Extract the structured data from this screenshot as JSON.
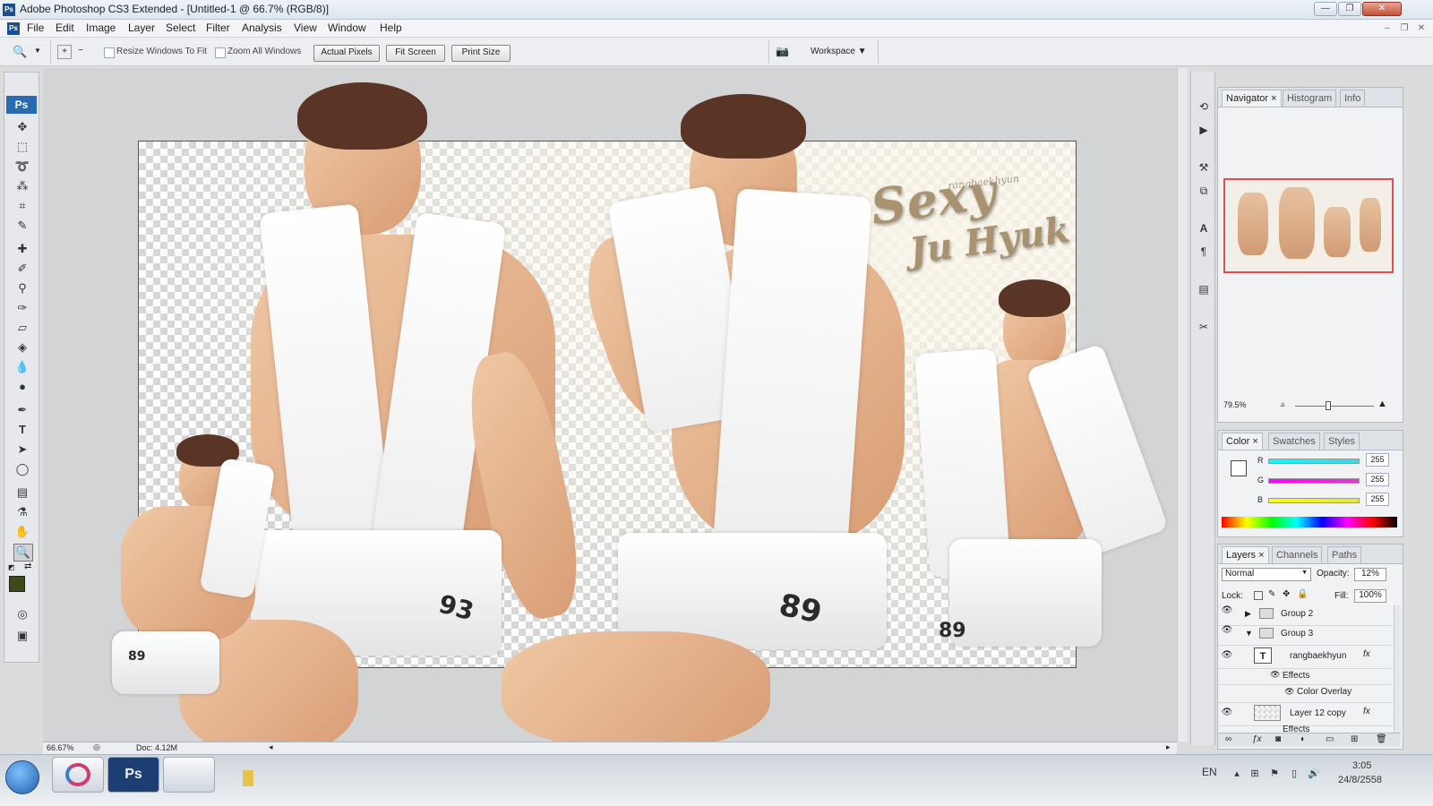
{
  "app": {
    "title": "Adobe Photoshop CS3 Extended - [Untitled-1 @ 66.7% (RGB/8)]",
    "ps_badge": "Ps"
  },
  "window_controls": {
    "minimize": "—",
    "restore": "❐",
    "close": "✕"
  },
  "menu": [
    "File",
    "Edit",
    "Image",
    "Layer",
    "Select",
    "Filter",
    "Analysis",
    "View",
    "Window",
    "Help"
  ],
  "doc_controls": {
    "minimize": "–",
    "restore": "❐",
    "close": "✕"
  },
  "options": {
    "resize_windows": "Resize Windows To Fit",
    "zoom_all": "Zoom All Windows",
    "actual_pixels": "Actual Pixels",
    "fit_screen": "Fit Screen",
    "print_size": "Print Size",
    "workspace": "Workspace ▼"
  },
  "canvas": {
    "title_line1": "Sexy",
    "title_line2": "Ju Hyuk",
    "credit": "rangbaekhyun",
    "jersey_left": "93",
    "jersey_mid": "89",
    "jersey_right": "89",
    "jersey_small": "89"
  },
  "status": {
    "zoom": "66.67%",
    "doc": "Doc: 4.12M"
  },
  "navigator": {
    "tabs": [
      "Navigator ×",
      "Histogram",
      "Info"
    ],
    "zoom": "79.5%"
  },
  "color_panel": {
    "tabs": [
      "Color ×",
      "Swatches",
      "Styles"
    ],
    "channels": [
      {
        "label": "R",
        "value": "255",
        "color": "#3fd4e6"
      },
      {
        "label": "G",
        "value": "255",
        "color": "#e03ccf"
      },
      {
        "label": "B",
        "value": "255",
        "color": "#e6e63a"
      }
    ]
  },
  "layers_panel": {
    "tabs": [
      "Layers ×",
      "Channels",
      "Paths"
    ],
    "blend_mode": "Normal",
    "opacity_label": "Opacity:",
    "opacity_value": "12%",
    "lock_label": "Lock:",
    "fill_label": "Fill:",
    "fill_value": "100%",
    "layers": [
      {
        "name": "Group 2",
        "type": "group"
      },
      {
        "name": "Group 3",
        "type": "group-open"
      },
      {
        "name": "rangbaekhyun",
        "type": "text",
        "fx": "fx"
      },
      {
        "name": "Effects",
        "type": "effects"
      },
      {
        "name": "Color Overlay",
        "type": "effect"
      },
      {
        "name": "Layer 12 copy",
        "type": "layer",
        "fx": "fx"
      },
      {
        "name": "Effects",
        "type": "effects"
      }
    ]
  },
  "taskbar": {
    "lang": "EN",
    "time": "3:05",
    "date": "24/8/2558",
    "ps_label": "Ps"
  },
  "colors": {
    "accent_red": "#e05050",
    "title_gold": "#a89270",
    "foreground_swatch": "#3b4a18"
  }
}
